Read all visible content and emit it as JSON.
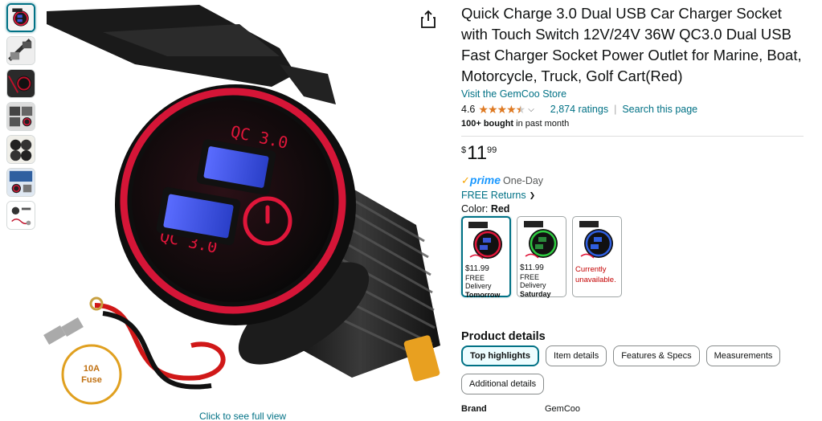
{
  "gallery": {
    "thumbnails": [
      {
        "name": "thumb-1",
        "accent": "#e0163a"
      },
      {
        "name": "thumb-2",
        "accent": "#333333"
      },
      {
        "name": "thumb-3",
        "accent": "#c0102a"
      },
      {
        "name": "thumb-4",
        "accent": "#444444"
      },
      {
        "name": "thumb-5",
        "accent": "#222222"
      },
      {
        "name": "thumb-6",
        "accent": "#3060a0"
      },
      {
        "name": "thumb-7",
        "accent": "#555555"
      }
    ],
    "fuse_label_1": "10A",
    "fuse_label_2": "Fuse",
    "socket_text": "QC 3.0",
    "full_view_link": "Click to see full view"
  },
  "product": {
    "title": "Quick Charge 3.0 Dual USB Car Charger Socket with Touch Switch 12V/24V 36W QC3.0 Dual USB Fast Charger Socket Power Outlet for Marine, Boat, Motorcycle, Truck, Golf Cart(Red)",
    "store_link": "Visit the GemCoo Store",
    "rating": "4.6",
    "stars_filled": 4.5,
    "ratings_count": "2,874 ratings",
    "search_link": "Search this page",
    "bought_bold": "100+ bought",
    "bought_rest": " in past month",
    "price_symbol": "$",
    "price_whole": "11",
    "price_fraction": "99",
    "prime_check": "✓",
    "prime_word": "prime",
    "prime_speed": "One-Day",
    "returns": "FREE Returns",
    "color_label": "Color: ",
    "color_value": "Red"
  },
  "swatches": [
    {
      "price": "$11.99",
      "line1": "FREE Delivery",
      "line2": "Tomorrow",
      "ring": "#e0163a",
      "usb": "#3a56d6"
    },
    {
      "price": "$11.99",
      "line1": "FREE Delivery",
      "line2": "Saturday",
      "ring": "#2ecc40",
      "usb": "#2a8a3a"
    },
    {
      "unavailable_1": "Currently",
      "unavailable_2": "unavailable.",
      "ring": "#2f5fe0",
      "usb": "#2f5fe0"
    }
  ],
  "details": {
    "heading": "Product details",
    "tabs": [
      "Top highlights",
      "Item details",
      "Features & Specs",
      "Measurements",
      "Additional details"
    ],
    "brand_key": "Brand",
    "brand_value": "GemCoo"
  },
  "colors": {
    "link": "#007185",
    "star": "#de7921",
    "prime": "#1a98ff",
    "ring": "#e0163a",
    "error": "#c40000"
  }
}
